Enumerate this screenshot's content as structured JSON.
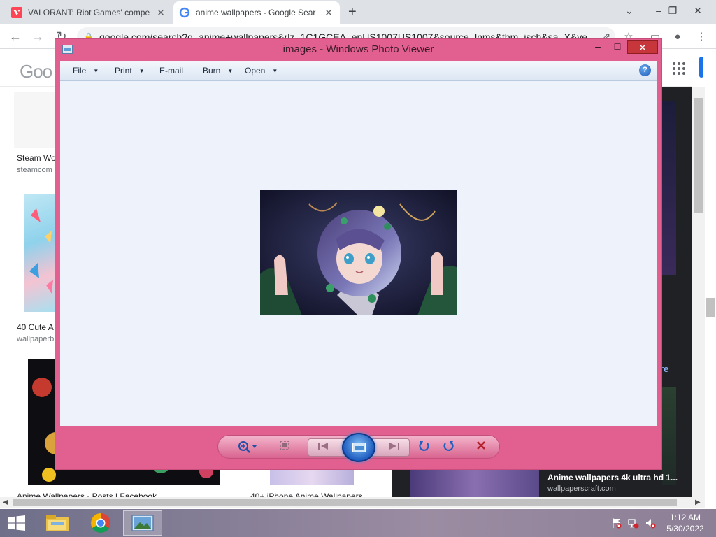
{
  "browser": {
    "tabs": [
      {
        "title": "VALORANT: Riot Games' compe",
        "active": false
      },
      {
        "title": "anime wallpapers - Google Sear",
        "active": true
      }
    ],
    "address": "google.com/search?q=anime+wallpapers&rlz=1C1GCEA_enUS1007US1007&source=lnms&tbm=isch&sa=X&ve"
  },
  "google": {
    "logo_text": "Goo",
    "results": [
      {
        "title": "Steam Wo",
        "source": "steamcom"
      },
      {
        "title": "40 Cute A",
        "source": "wallpaperb"
      },
      {
        "title": "Anime Wallpapers - Posts | Facebook",
        "source": ""
      },
      {
        "title": "40+ iPhone Anime Wallpapers",
        "source": ""
      }
    ],
    "panel": {
      "more_link": "ore",
      "title": "Anime wallpapers 4k ultra hd 1...",
      "source": "wallpaperscraft.com"
    }
  },
  "photo_viewer": {
    "title": "images - Windows Photo Viewer",
    "menu": {
      "file": "File",
      "print": "Print",
      "email": "E-mail",
      "burn": "Burn",
      "open": "Open"
    },
    "help_glyph": "?"
  },
  "taskbar": {
    "time": "1:12 AM",
    "date": "5/30/2022"
  },
  "colors": {
    "viewer_frame": "#e2608f",
    "viewer_canvas": "#eef2fa",
    "close_red": "#c7363b",
    "chrome_tabbar": "#dee1e6"
  }
}
